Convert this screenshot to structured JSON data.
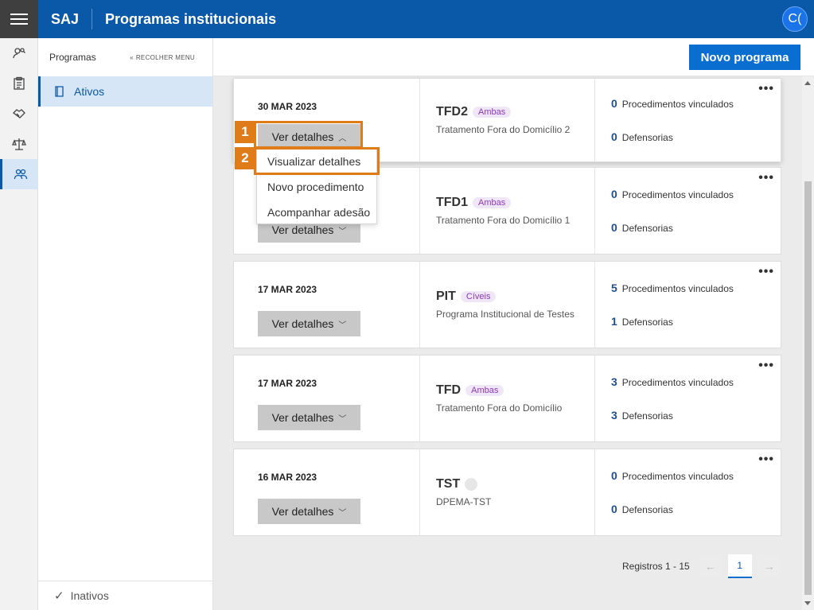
{
  "header": {
    "brand": "SAJ",
    "title": "Programas institucionais",
    "avatar_initials": "C("
  },
  "rail": {
    "icons": [
      "person-search-icon",
      "clipboard-icon",
      "handshake-icon",
      "scales-icon",
      "people-icon"
    ],
    "active_index": 4
  },
  "panel": {
    "title": "Programas",
    "collapse_label": "RECOLHER MENU",
    "active_item": "Ativos",
    "footer_item": "Inativos"
  },
  "toolbar": {
    "new_button": "Novo programa"
  },
  "cards": [
    {
      "date": "30 MAR 2023",
      "details": "Ver detalhes",
      "code": "TFD2",
      "tag": "Ambas",
      "name": "Tratamento Fora do Domicílio 2",
      "procedures": "0",
      "defensorias": "0"
    },
    {
      "date": "",
      "details": "Ver detalhes",
      "code": "TFD1",
      "tag": "Ambas",
      "name": "Tratamento Fora do Domicílio 1",
      "procedures": "0",
      "defensorias": "0"
    },
    {
      "date": "17 MAR 2023",
      "details": "Ver detalhes",
      "code": "PIT",
      "tag": "Cíveis",
      "name": "Programa Institucional de Testes",
      "procedures": "5",
      "defensorias": "1"
    },
    {
      "date": "17 MAR 2023",
      "details": "Ver detalhes",
      "code": "TFD",
      "tag": "Ambas",
      "name": "Tratamento Fora do Domicílio",
      "procedures": "3",
      "defensorias": "3"
    },
    {
      "date": "16 MAR 2023",
      "details": "Ver detalhes",
      "code": "TST",
      "tag": "",
      "name": "DPEMA-TST",
      "procedures": "0",
      "defensorias": "0"
    }
  ],
  "labels": {
    "procedures": "Procedimentos vinculados",
    "defensorias": "Defensorias",
    "more": "•••"
  },
  "dropdown": {
    "items": [
      "Visualizar detalhes",
      "Novo procedimento",
      "Acompanhar adesão"
    ]
  },
  "annotations": {
    "step1": "1",
    "step2": "2",
    "color": "#e07b1a"
  },
  "pagination": {
    "text": "Registros 1 - 15",
    "current_page": "1",
    "prev": "←",
    "next": "→"
  },
  "colors": {
    "primary": "#0a58a8",
    "button": "#0a6ed1",
    "tag": "#8a3ab9"
  }
}
